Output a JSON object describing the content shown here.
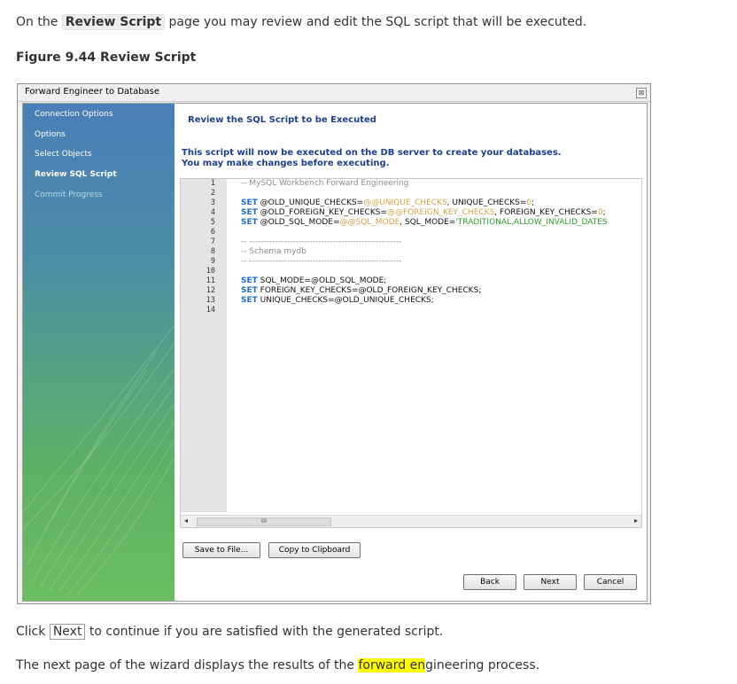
{
  "intro": {
    "before": "On the ",
    "command": "Review Script",
    "after": " page you may review and edit the SQL script that will be executed."
  },
  "figure_title": "Figure 9.44 Review Script",
  "window": {
    "title": "Forward Engineer to Database",
    "close_glyph": "⊠",
    "sidebar": [
      "Connection Options",
      "Options",
      "Select Objects",
      "Review SQL Script",
      "Commit Progress"
    ],
    "heading": "Review the SQL Script to be Executed",
    "description_line1": "This script will now be executed on the DB server to create your databases.",
    "description_line2": "You may make changes before executing.",
    "line_numbers": [
      "1",
      "2",
      "3",
      "4",
      "5",
      "6",
      "7",
      "8",
      "9",
      "10",
      "11",
      "12",
      "13",
      "14"
    ],
    "code": {
      "line1": "-- MySQL Workbench Forward Engineering",
      "kw_set": "SET",
      "l3_a": " @OLD_UNIQUE_CHECKS=",
      "l3_b": "@@UNIQUE_CHECKS",
      "l3_c": ", UNIQUE_CHECKS=",
      "l3_d": "0",
      "l3_e": ";",
      "l4_a": " @OLD_FOREIGN_KEY_CHECKS=",
      "l4_b": "@@FOREIGN_KEY_CHECKS",
      "l4_c": ", FOREIGN_KEY_CHECKS=",
      "l4_d": "0",
      "l4_e": ";",
      "l5_a": " @OLD_SQL_MODE=",
      "l5_b": "@@SQL_MODE",
      "l5_c": ", SQL_MODE=",
      "l5_d": "'TRADITIONAL,ALLOW_INVALID_DATES",
      "line7": "-- -----------------------------------------------------",
      "line8": "-- Schema mydb",
      "line9": "-- -----------------------------------------------------",
      "l11": " SQL_MODE=@OLD_SQL_MODE;",
      "l12": " FOREIGN_KEY_CHECKS=@OLD_FOREIGN_KEY_CHECKS;",
      "l13": " UNIQUE_CHECKS=@OLD_UNIQUE_CHECKS;"
    },
    "scroll_left": "◂",
    "scroll_right": "▸",
    "scroll_thumb": "III",
    "buttons": {
      "save": "Save to File...",
      "copy": "Copy to Clipboard",
      "back": "Back",
      "next": "Next",
      "cancel": "Cancel"
    }
  },
  "post1": {
    "before": "Click ",
    "key": "Next",
    "after": " to continue if you are satisfied with the generated script."
  },
  "post2": {
    "before": "The next page of the wizard displays the results of the ",
    "highlight": "forward en",
    "after": "gineering process."
  }
}
